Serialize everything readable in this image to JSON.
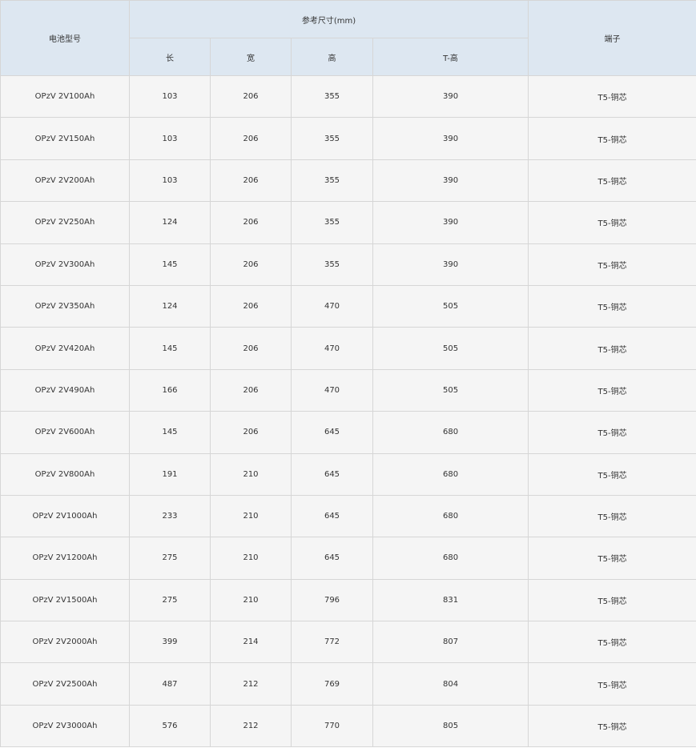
{
  "header": {
    "model": "电池型号",
    "dimensions_group": "参考尺寸(mm)",
    "length": "长",
    "width": "宽",
    "height": "高",
    "total_height": "T-高",
    "terminal": "端子"
  },
  "rows": [
    {
      "model": "OPzV 2V100Ah",
      "length": "103",
      "width": "206",
      "height": "355",
      "total_height": "390",
      "terminal": "T5-铜芯"
    },
    {
      "model": "OPzV 2V150Ah",
      "length": "103",
      "width": "206",
      "height": "355",
      "total_height": "390",
      "terminal": "T5-铜芯"
    },
    {
      "model": "OPzV 2V200Ah",
      "length": "103",
      "width": "206",
      "height": "355",
      "total_height": "390",
      "terminal": "T5-铜芯"
    },
    {
      "model": "OPzV 2V250Ah",
      "length": "124",
      "width": "206",
      "height": "355",
      "total_height": "390",
      "terminal": "T5-铜芯"
    },
    {
      "model": "OPzV 2V300Ah",
      "length": "145",
      "width": "206",
      "height": "355",
      "total_height": "390",
      "terminal": "T5-铜芯"
    },
    {
      "model": "OPzV 2V350Ah",
      "length": "124",
      "width": "206",
      "height": "470",
      "total_height": "505",
      "terminal": "T5-铜芯"
    },
    {
      "model": "OPzV 2V420Ah",
      "length": "145",
      "width": "206",
      "height": "470",
      "total_height": "505",
      "terminal": "T5-铜芯"
    },
    {
      "model": "OPzV 2V490Ah",
      "length": "166",
      "width": "206",
      "height": "470",
      "total_height": "505",
      "terminal": "T5-铜芯"
    },
    {
      "model": "OPzV 2V600Ah",
      "length": "145",
      "width": "206",
      "height": "645",
      "total_height": "680",
      "terminal": "T5-铜芯"
    },
    {
      "model": "OPzV 2V800Ah",
      "length": "191",
      "width": "210",
      "height": "645",
      "total_height": "680",
      "terminal": "T5-铜芯"
    },
    {
      "model": "OPzV 2V1000Ah",
      "length": "233",
      "width": "210",
      "height": "645",
      "total_height": "680",
      "terminal": "T5-铜芯"
    },
    {
      "model": "OPzV 2V1200Ah",
      "length": "275",
      "width": "210",
      "height": "645",
      "total_height": "680",
      "terminal": "T5-铜芯"
    },
    {
      "model": "OPzV 2V1500Ah",
      "length": "275",
      "width": "210",
      "height": "796",
      "total_height": "831",
      "terminal": "T5-铜芯"
    },
    {
      "model": "OPzV 2V2000Ah",
      "length": "399",
      "width": "214",
      "height": "772",
      "total_height": "807",
      "terminal": "T5-铜芯"
    },
    {
      "model": "OPzV 2V2500Ah",
      "length": "487",
      "width": "212",
      "height": "769",
      "total_height": "804",
      "terminal": "T5-铜芯"
    },
    {
      "model": "OPzV 2V3000Ah",
      "length": "576",
      "width": "212",
      "height": "770",
      "total_height": "805",
      "terminal": "T5-铜芯"
    }
  ]
}
